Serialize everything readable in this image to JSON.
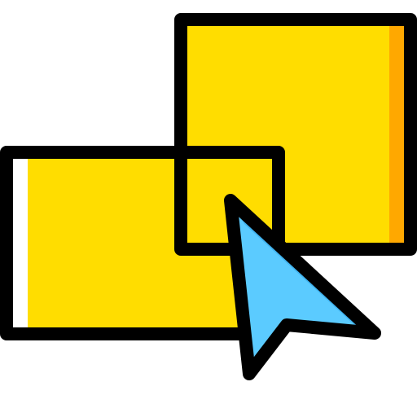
{
  "icon": {
    "name": "select-overlapping-shapes-icon",
    "colors": {
      "outline": "#000000",
      "shape_fill": "#FFDD00",
      "shape_shadow": "#FFA800",
      "shape_highlight": "#FFFFFF",
      "cursor_fill": "#5BCBFF",
      "cursor_shadow": "#40B3F0"
    }
  }
}
